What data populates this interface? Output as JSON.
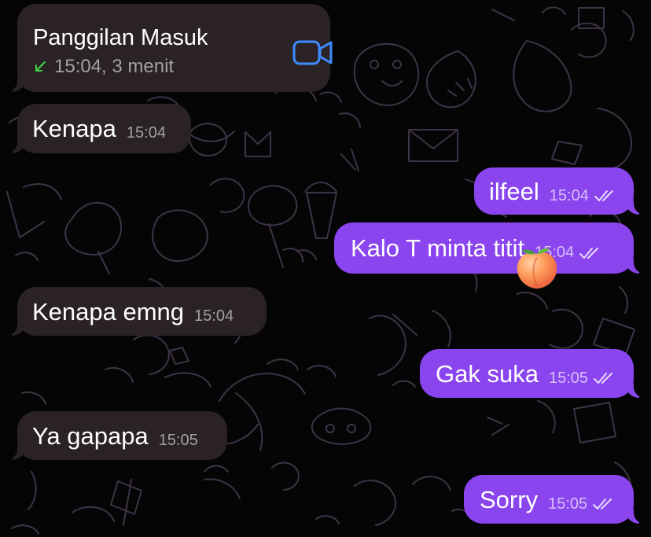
{
  "colors": {
    "background": "#050505",
    "incoming_bubble": "#2a2225",
    "outgoing_bubble": "#8a45ee",
    "call_icon": "#3d8cff",
    "incoming_call_arrow": "#3fd34e",
    "wallpaper_lines": "#5a4a66"
  },
  "call": {
    "title": "Panggilan Masuk",
    "details": "15:04, 3 menit",
    "direction_icon": "incoming-call-arrow-icon",
    "call_type_icon": "video-camera-icon"
  },
  "messages": [
    {
      "direction": "incoming",
      "text": "Kenapa",
      "time": "15:04"
    },
    {
      "direction": "outgoing",
      "text": "ilfeel",
      "time": "15:04",
      "status_icon": "double-check-icon"
    },
    {
      "direction": "outgoing",
      "text": "Kalo T minta titit",
      "time": "15:04",
      "status_icon": "double-check-icon",
      "reaction_icon": "peach-emoji-icon"
    },
    {
      "direction": "incoming",
      "text": "Kenapa emng",
      "time": "15:04"
    },
    {
      "direction": "outgoing",
      "text": "Gak suka",
      "time": "15:05",
      "status_icon": "double-check-icon"
    },
    {
      "direction": "incoming",
      "text": "Ya gapapa",
      "time": "15:05"
    },
    {
      "direction": "outgoing",
      "text": "Sorry",
      "time": "15:05",
      "status_icon": "double-check-icon"
    }
  ]
}
